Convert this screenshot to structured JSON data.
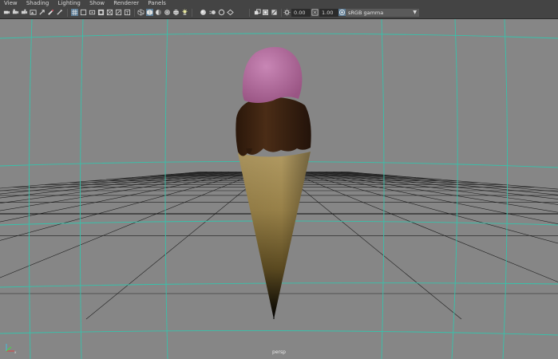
{
  "menu": {
    "items": [
      "View",
      "Shading",
      "Lighting",
      "Show",
      "Renderer",
      "Panels"
    ]
  },
  "toolbar": {
    "exposure_value": "0.00",
    "gamma_value": "1.00",
    "color_space": "sRGB gamma",
    "icons": [
      "select-camera-icon",
      "camera-attributes-icon",
      "bookmark-icon",
      "image-plane-icon",
      "2d-pan-zoom-icon",
      "grease-pencil-icon",
      "grid-icon",
      "film-gate-icon",
      "resolution-gate-icon",
      "gate-mask-icon",
      "field-chart-icon",
      "safe-action-icon",
      "safe-title-icon",
      "wireframe-icon",
      "smooth-shade-icon",
      "default-material-icon",
      "textured-icon",
      "use-all-lights-icon",
      "shadows-icon",
      "ambient-occlusion-icon",
      "motion-blur-icon",
      "anti-aliasing-icon",
      "depth-of-field-icon",
      "isolate-select-icon",
      "xray-icon",
      "xray-joints-icon",
      "backface-culling-icon",
      "exposure-icon",
      "gamma-icon",
      "color-management-icon"
    ]
  },
  "viewport": {
    "camera_label": "persp",
    "colors": {
      "background": "#868686",
      "grid": "#1e1e1e",
      "grid_axis": "#0a0a0a",
      "gate_lines": "#37c2ab",
      "scoop": "#b16c9e",
      "chocolate": "#3a2312",
      "cone": "#a38c58"
    }
  }
}
